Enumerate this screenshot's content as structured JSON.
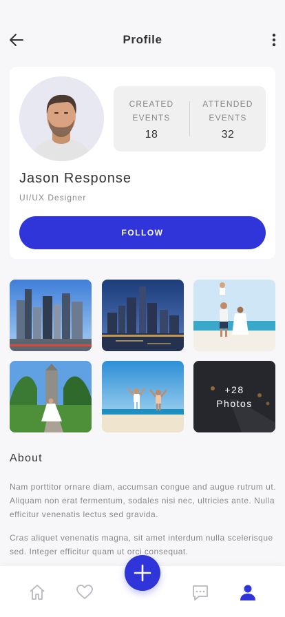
{
  "header": {
    "title": "Profile",
    "back_icon": "arrow-left-icon",
    "more_icon": "more-vertical-icon"
  },
  "profile": {
    "name": "Jason Response",
    "role": "UI/UX Designer",
    "stats": [
      {
        "label_line1": "CREATED",
        "label_line2": "EVENTS",
        "value": "18"
      },
      {
        "label_line1": "ATTENDED",
        "label_line2": "EVENTS",
        "value": "32"
      }
    ],
    "follow_label": "FOLLOW"
  },
  "photos": {
    "items": [
      "city-skyline",
      "night-city",
      "beach-family",
      "garden-bride",
      "beach-jump",
      "road-lights"
    ],
    "more_count": "+28",
    "more_label": "Photos"
  },
  "about": {
    "title": "About",
    "paragraphs": [
      "Nam porttitor ornare diam, accumsan congue and augue rutrum ut. Aliquam non erat fermentum, sodales nisi nec, ultricies ante. Nulla efficitur venenatis lectus sed gravida.",
      "Cras aliquet venenatis magna, sit amet interdum nulla scelerisque sed. Integer efficitur quam ut orci consequat."
    ]
  },
  "nav": {
    "items": [
      "home-icon",
      "heart-icon",
      "add-icon",
      "chat-icon",
      "user-icon"
    ],
    "active": "user-icon"
  },
  "colors": {
    "accent": "#2f35d8",
    "inactive_icon": "#b8b8c0",
    "background": "#f7f7f9"
  }
}
